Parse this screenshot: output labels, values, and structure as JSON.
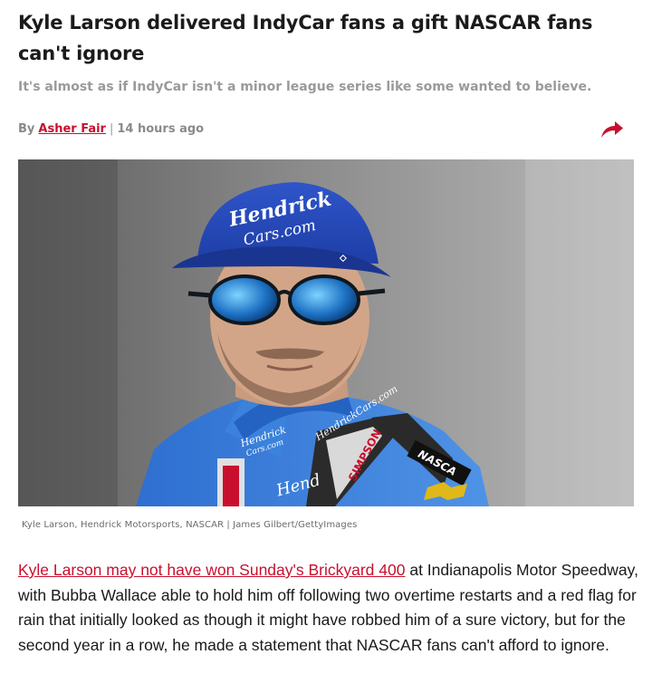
{
  "article": {
    "headline": "Kyle Larson delivered IndyCar fans a gift NASCAR fans can't ignore",
    "dek": "It's almost as if IndyCar isn't a minor league series like some wanted to believe.",
    "byline_prefix": "By",
    "author": "Asher Fair",
    "separator": "|",
    "timestamp": "14 hours ago",
    "share_icon": "share-arrow-icon",
    "accent_color": "#c8102e"
  },
  "photo": {
    "cap_text_1": "Hendrick",
    "cap_text_2": "Cars.com",
    "suit_text_1": "HendrickCars.com",
    "suit_text_2": "Hendrick",
    "suit_text_3": "Cars.com",
    "belt_text": "SIMPSON",
    "nascar_text": "NASCA",
    "hand_text": "Hend"
  },
  "caption": "Kyle Larson, Hendrick Motorsports, NASCAR | James Gilbert/GettyImages",
  "body": {
    "link_text": "Kyle Larson may not have won Sunday's Brickyard 400",
    "text": " at Indianapolis Motor Speedway, with Bubba Wallace able to hold him off following two overtime restarts and a red flag for rain that initially looked as though it might have robbed him of a sure victory, but for the second year in a row, he made a statement that NASCAR fans can't afford to ignore."
  }
}
